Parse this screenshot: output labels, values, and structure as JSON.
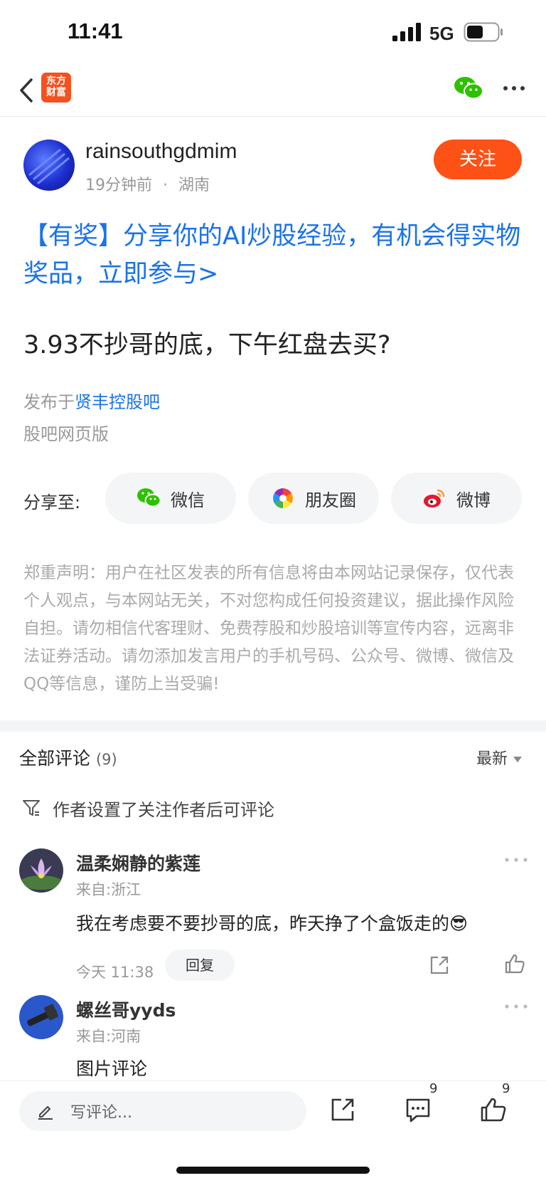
{
  "status_bar": {
    "time": "11:41",
    "network": "5G"
  },
  "nav": {
    "logo_line1": "东方",
    "logo_line2": "财富"
  },
  "author": {
    "name": "rainsouthgdmim",
    "time": "19分钟前",
    "separator": "·",
    "location": "湖南",
    "follow_label": "关注"
  },
  "post": {
    "promo": "【有奖】分享你的AI炒股经验，有机会得实物奖品，立即参与>",
    "title": "3.93不抄哥的底，下午红盘去买?",
    "published_prefix": "发布于",
    "forum": "贤丰控股吧",
    "web_version": "股吧网页版"
  },
  "share": {
    "label": "分享至:",
    "wechat": "微信",
    "moments": "朋友圈",
    "weibo": "微博"
  },
  "disclaimer": "郑重声明：用户在社区发表的所有信息将由本网站记录保存，仅代表个人观点，与本网站无关，不对您构成任何投资建议，据此操作风险自担。请勿相信代客理财、免费荐股和炒股培训等宣传内容，远离非法证券活动。请勿添加发言用户的手机号码、公众号、微博、微信及QQ等信息，谨防上当受骗!",
  "comments": {
    "title": "全部评论",
    "count": "(9)",
    "sort": "最新",
    "limit_notice": "作者设置了关注作者后可评论",
    "items": [
      {
        "name": "温柔娴静的紫莲",
        "location": "来自:浙江",
        "text": "我在考虑要不要抄哥的底，昨天挣了个盒饭走的😎",
        "time": "今天 11:38",
        "reply_label": "回复"
      },
      {
        "name": "螺丝哥yyds",
        "location": "来自:河南",
        "text": "图片评论"
      }
    ]
  },
  "bottom_bar": {
    "input_placeholder": "写评论...",
    "comment_badge": "9",
    "like_badge": "9"
  },
  "colors": {
    "accent_orange": "#fe5116",
    "link_blue": "#1a73e8"
  }
}
